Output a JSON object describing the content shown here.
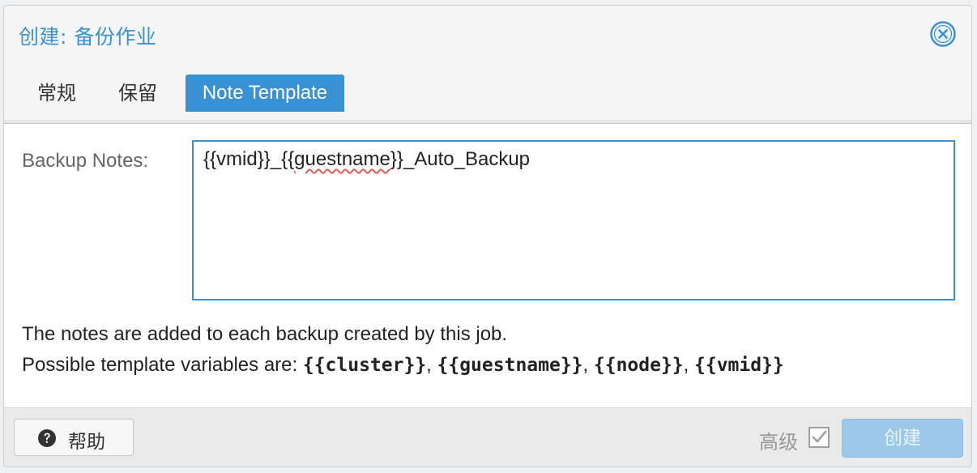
{
  "dialog": {
    "title": "创建: 备份作业",
    "close_icon": "close-circle-icon"
  },
  "tabs": [
    {
      "label": "常规",
      "active": false
    },
    {
      "label": "保留",
      "active": false
    },
    {
      "label": "Note Template",
      "active": true
    }
  ],
  "form": {
    "notes_label": "Backup Notes:",
    "notes_value_prefix": "{{vmid}}_{{",
    "notes_value_squiggle": "guestname",
    "notes_value_suffix": "}}_Auto_Backup"
  },
  "help": {
    "line1": "The notes are added to each backup created by this job.",
    "line2_prefix": "Possible template variables are: ",
    "variables": [
      "{{cluster}}",
      "{{guestname}}",
      "{{node}}",
      "{{vmid}}"
    ],
    "separator": ", "
  },
  "footer": {
    "help_label": "帮助",
    "help_icon": "question-circle-icon",
    "advanced_label": "高级",
    "advanced_checked": true,
    "create_label": "创建",
    "create_enabled": false
  },
  "colors": {
    "accent": "#3892d4",
    "create_disabled": "#9cc8ea"
  }
}
